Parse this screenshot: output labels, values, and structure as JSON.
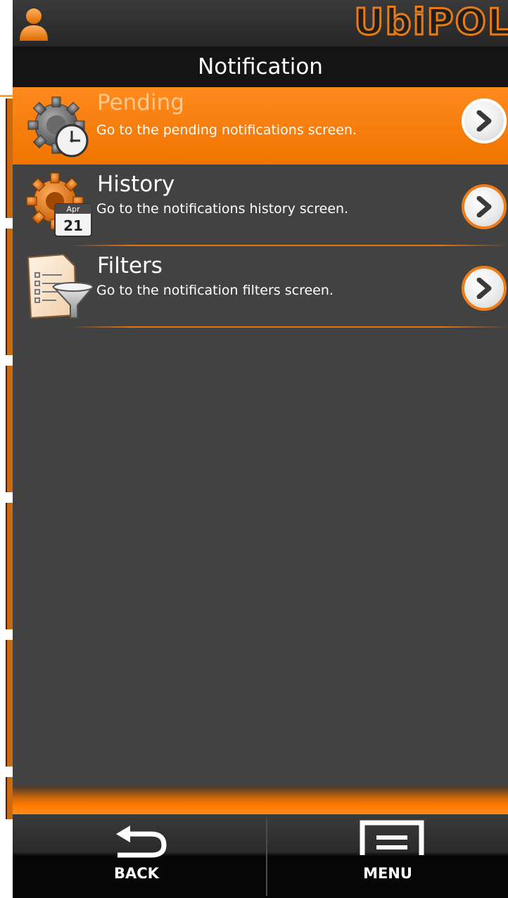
{
  "app": {
    "brand": "UbiPOL",
    "screen_title": "Notification"
  },
  "menu_items": [
    {
      "label": "Pending",
      "description": "Go to the pending notifications screen.",
      "icon": "gear-clock-icon",
      "selected": true
    },
    {
      "label": "History",
      "description": "Go to the notifications history screen.",
      "icon": "gear-calendar-icon",
      "calendar_month": "Apr",
      "calendar_day": "21",
      "selected": false
    },
    {
      "label": "Filters",
      "description": "Go to the notification filters screen.",
      "icon": "document-funnel-icon",
      "selected": false
    }
  ],
  "navbar": {
    "back_label": "BACK",
    "menu_label": "MENU"
  },
  "colors": {
    "accent": "#f07400",
    "background": "#424242",
    "title_bar": "#141414"
  }
}
